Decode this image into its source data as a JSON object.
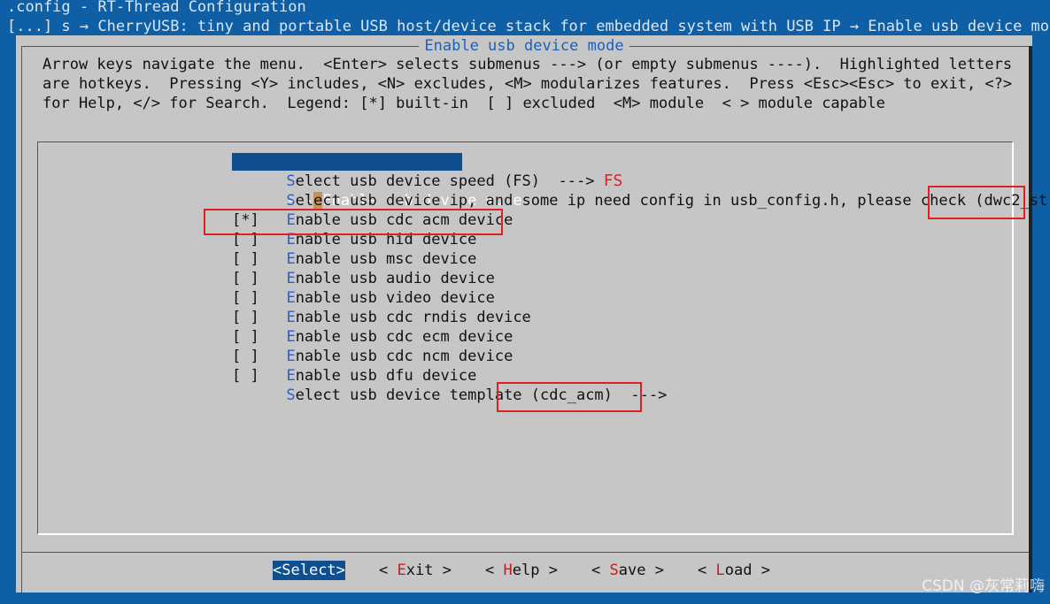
{
  "header": {
    "line1": ".config - RT-Thread Configuration",
    "line2": "[...] s → CherryUSB: tiny and portable USB host/device stack for embedded system with USB IP → Enable usb device mode"
  },
  "dialog": {
    "title": "Enable usb device mode",
    "help": [
      "Arrow keys navigate the menu.  <Enter> selects submenus ---> (or empty submenus ----).  Highlighted letters",
      "are hotkeys.  Pressing <Y> includes, <N> excludes, <M> modularizes features.  Press <Esc><Esc> to exit, <?>",
      "for Help, </> for Search.  Legend: [*] built-in  [ ] excluded  <M> module  < > module capable"
    ]
  },
  "menu": {
    "selected": {
      "prefix": "---",
      "label": "Enable usb device mode"
    },
    "speed": {
      "hotkey": "S",
      "rest": "elect usb device speed (FS)  --->",
      "annotation": "FS"
    },
    "ip": {
      "hotkey": "S",
      "rest": "elect usb device ip, and some ip need config in usb_config.h, please check ",
      "value": "(dwc2_st"
    },
    "items": [
      {
        "check": "[*]",
        "hotkey": "E",
        "rest": "nable usb cdc acm device"
      },
      {
        "check": "[ ]",
        "hotkey": "E",
        "rest": "nable usb hid device"
      },
      {
        "check": "[ ]",
        "hotkey": "E",
        "rest": "nable usb msc device"
      },
      {
        "check": "[ ]",
        "hotkey": "E",
        "rest": "nable usb audio device"
      },
      {
        "check": "[ ]",
        "hotkey": "E",
        "rest": "nable usb video device"
      },
      {
        "check": "[ ]",
        "hotkey": "E",
        "rest": "nable usb cdc rndis device"
      },
      {
        "check": "[ ]",
        "hotkey": "E",
        "rest": "nable usb cdc ecm device"
      },
      {
        "check": "[ ]",
        "hotkey": "E",
        "rest": "nable usb cdc ncm device"
      },
      {
        "check": "[ ]",
        "hotkey": "E",
        "rest": "nable usb dfu device"
      }
    ],
    "template": {
      "hotkey": "S",
      "rest": "elect usb device template ",
      "value": "(cdc_acm)",
      "arrow": "  --->"
    }
  },
  "buttons": [
    {
      "pre": "<",
      "hotkey": "",
      "text": "Select",
      "post": ">",
      "active": true
    },
    {
      "pre": "< ",
      "hotkey": "E",
      "text": "xit",
      "post": " >",
      "active": false
    },
    {
      "pre": "< ",
      "hotkey": "H",
      "text": "elp",
      "post": " >",
      "active": false
    },
    {
      "pre": "< ",
      "hotkey": "S",
      "text": "ave",
      "post": " >",
      "active": false
    },
    {
      "pre": "< ",
      "hotkey": "L",
      "text": "oad",
      "post": " >",
      "active": false
    }
  ],
  "watermark": "CSDN @灰常莉嗨",
  "colors": {
    "background": "#0f5fa6",
    "dialog": "#c6c6c6",
    "selection": "#0f4f8f",
    "hotkey_menu": "#2a5fd0",
    "hotkey_button": "#c02020",
    "annotation": "#e02020"
  }
}
